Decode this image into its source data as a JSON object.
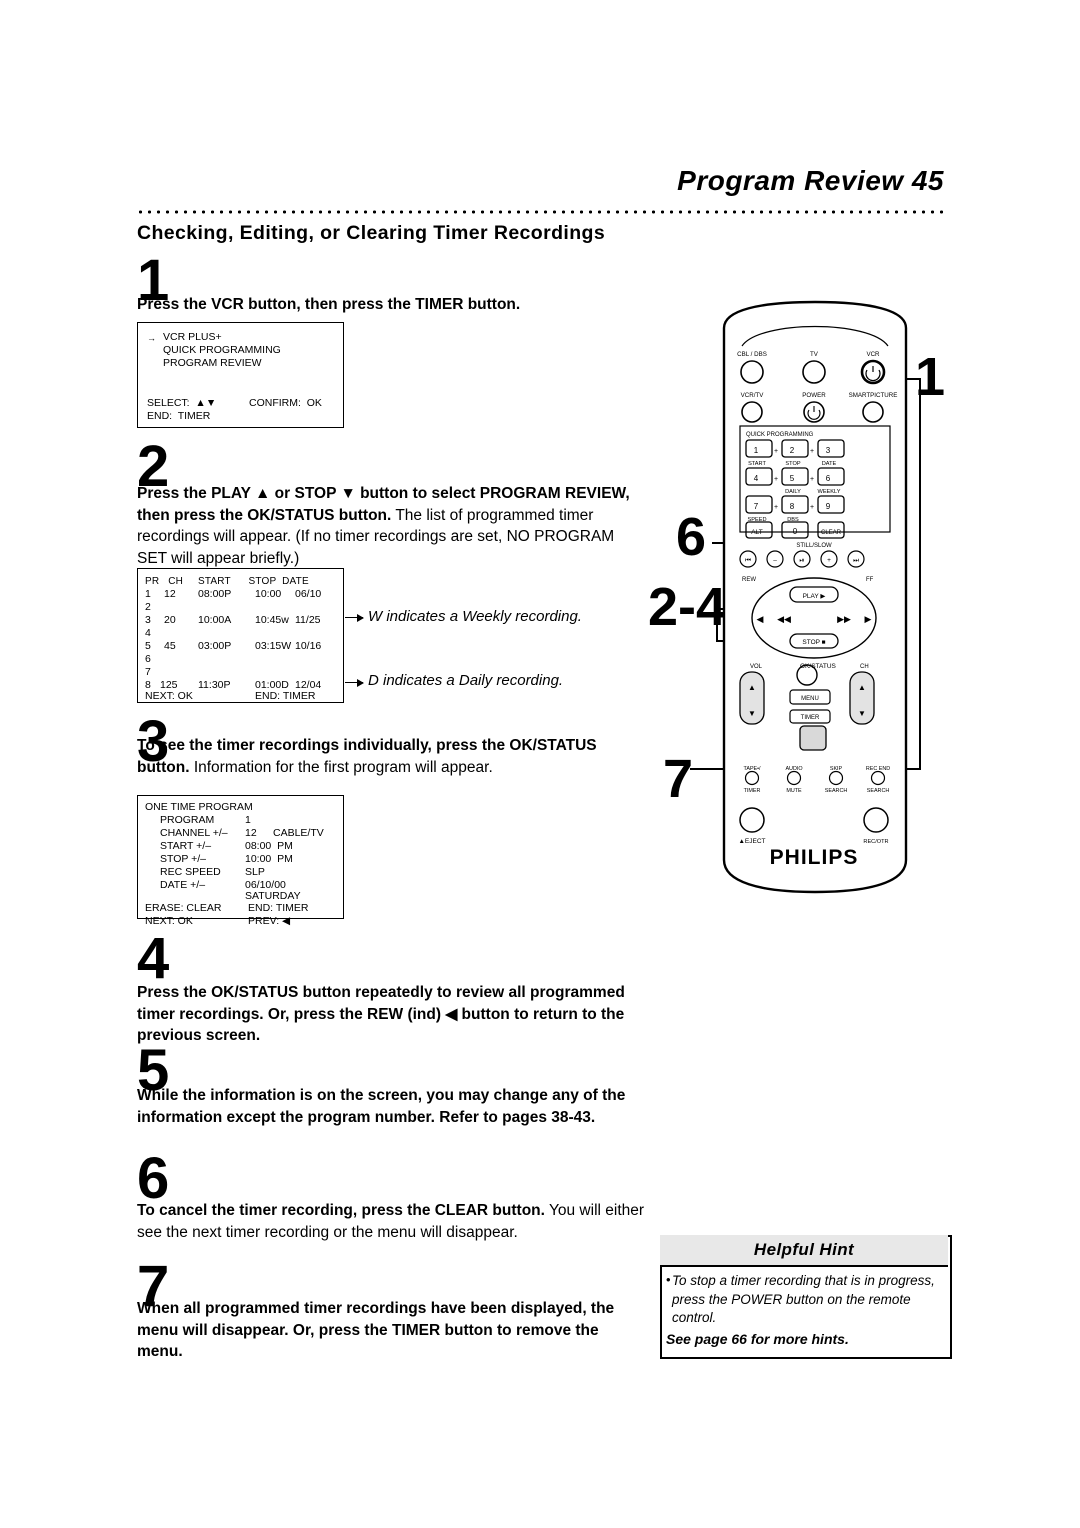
{
  "header": {
    "title": "Program Review  45",
    "subhead": "Checking, Editing, or Clearing Timer Recordings"
  },
  "steps": [
    {
      "num": "1",
      "text_html": "<b>Press the VCR button, then press the TIMER button.</b>"
    },
    {
      "num": "2",
      "text_html": "<b>Press the PLAY &#9650; or STOP &#9660; button to select PROGRAM REVIEW, then press the OK/STATUS button.</b> The list of programmed timer recordings will appear. (If no timer recordings are set, NO PROGRAM SET will appear briefly.)"
    },
    {
      "num": "3",
      "text_html": "<b>To see the timer recordings individually, press the OK/STATUS button.</b> Information for the first program will appear."
    },
    {
      "num": "4",
      "text_html": "<b>Press the OK/STATUS button repeatedly to review all programmed timer recordings. Or, press the REW (ind) &#9664; button to return to the previous screen.</b>"
    },
    {
      "num": "5",
      "text_html": "<b>While the information is on the screen, you may change any of the information except the program number.  Refer to pages 38-43.</b>"
    },
    {
      "num": "6",
      "text_html": "<b>To cancel the timer recording, press the CLEAR button.</b> You will either see the next timer recording or the menu will disappear."
    },
    {
      "num": "7",
      "text_html": "<b>When all programmed timer recordings have been displayed, the menu will disappear. Or, press the TIMER button to remove the menu.</b>"
    }
  ],
  "osd_menu": {
    "items": [
      "VCR PLUS+",
      "QUICK PROGRAMMING",
      "PROGRAM REVIEW"
    ],
    "select_label": "SELECT:  ▲▼",
    "confirm_label": "CONFIRM:  OK",
    "end_label": "END:  TIMER"
  },
  "osd_list": {
    "headers": [
      "PR",
      "CH",
      "START",
      "STOP",
      "DATE"
    ],
    "rows": [
      {
        "pr": "1",
        "ch": "12",
        "start": "08:00P",
        "stop": "10:00",
        "date": "06/10"
      },
      {
        "pr": "2",
        "ch": "",
        "start": "",
        "stop": "",
        "date": ""
      },
      {
        "pr": "3",
        "ch": "20",
        "start": "10:00A",
        "stop": "10:45w",
        "date": "11/25"
      },
      {
        "pr": "4",
        "ch": "",
        "start": "",
        "stop": "",
        "date": ""
      },
      {
        "pr": "5",
        "ch": "45",
        "start": "03:00P",
        "stop": "03:15W",
        "date": "10/16"
      },
      {
        "pr": "6",
        "ch": "",
        "start": "",
        "stop": "",
        "date": ""
      },
      {
        "pr": "7",
        "ch": "",
        "start": "",
        "stop": "",
        "date": ""
      },
      {
        "pr": "8",
        "ch": "125",
        "start": "11:30P",
        "stop": "01:00D",
        "date": "12/04"
      }
    ],
    "next_label": "NEXT: OK",
    "end_label": "END: TIMER"
  },
  "osd_detail": {
    "title": "ONE TIME PROGRAM",
    "rows": [
      {
        "label": "PROGRAM",
        "v1": "1",
        "v2": ""
      },
      {
        "label": "CHANNEL +/–",
        "v1": "12",
        "v2": "CABLE/TV"
      },
      {
        "label": "START +/–",
        "v1": "08:00  PM",
        "v2": ""
      },
      {
        "label": "STOP +/–",
        "v1": "10:00  PM",
        "v2": ""
      },
      {
        "label": "REC SPEED",
        "v1": "SLP",
        "v2": ""
      },
      {
        "label": "DATE +/–",
        "v1": "06/10/00",
        "v2": ""
      },
      {
        "label": "",
        "v1": "SATURDAY",
        "v2": ""
      }
    ],
    "erase_label": "ERASE: CLEAR",
    "end_label": "END: TIMER",
    "next_label": "NEXT: OK",
    "prev_label": "PREV: ◀"
  },
  "annotations": {
    "weekly": "W indicates a Weekly recording.",
    "daily": "D indicates a Daily recording."
  },
  "callouts": {
    "one": "1",
    "six": "6",
    "two_four": "2-4",
    "seven": "7"
  },
  "hint": {
    "title": "Helpful Hint",
    "bullet": "•",
    "body": "To stop a timer recording that is in progress, press the POWER button on the remote control.",
    "footer": "See page 66 for more hints."
  },
  "remote": {
    "brand": "PHILIPS",
    "source_buttons": [
      "CBL / DBS",
      "TV",
      "VCR"
    ],
    "row2": [
      "VCR/TV",
      "POWER",
      "SMARTPICTURE"
    ],
    "quick_prog_label": "QUICK PROGRAMMING",
    "keypad": [
      "1",
      "2",
      "3",
      "4",
      "5",
      "6",
      "7",
      "8",
      "9",
      "ALT",
      "0",
      "CLEAR"
    ],
    "keypad_sublabels": [
      "START",
      "STOP",
      "DATE",
      "DAILY",
      "WEEKLY",
      "SPEED",
      "DBS"
    ],
    "still_slow_label": "STILL/SLOW",
    "transport_top": [
      "⏮",
      "–",
      "⏸",
      "+",
      "⏭"
    ],
    "rew_label": "REW",
    "ff_label": "FF",
    "play_label": "PLAY ▶",
    "stop_label": "STOP ■",
    "vol_label": "VOL",
    "ok_label": "OK/STATUS",
    "ch_label": "CH",
    "menu_label": "MENU",
    "timer_label": "TIMER",
    "bottom_row1": [
      "TAPE•/",
      "AUDIO",
      "SKIP",
      "REC END"
    ],
    "bottom_row2": [
      "TIMER",
      "MUTE",
      "SEARCH",
      "SEARCH"
    ],
    "eject_label": "▲EJECT",
    "rec_otr_label": "REC/OTR"
  }
}
